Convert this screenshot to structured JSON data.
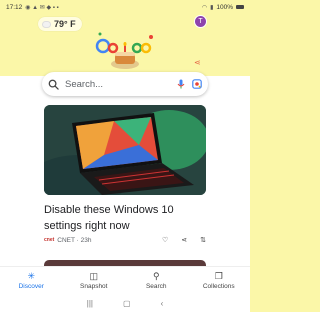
{
  "status": {
    "time": "17:12",
    "battery": "100%"
  },
  "weather": {
    "temperature": "79° F"
  },
  "avatar": {
    "initial": "T"
  },
  "search": {
    "placeholder": "Search..."
  },
  "card": {
    "title": "Disable these Windows 10 settings right now",
    "source_logo": "cnet",
    "source": "CNET · 23h"
  },
  "bottom_nav": {
    "items": [
      {
        "label": "Discover",
        "icon": "asterisk-icon"
      },
      {
        "label": "Snapshot",
        "icon": "snapshot-icon"
      },
      {
        "label": "Search",
        "icon": "search-icon"
      },
      {
        "label": "Collections",
        "icon": "collections-icon"
      }
    ]
  },
  "colors": {
    "header_bg": "#fbf7a8",
    "accent": "#1a73e8",
    "avatar": "#8e44ad"
  }
}
